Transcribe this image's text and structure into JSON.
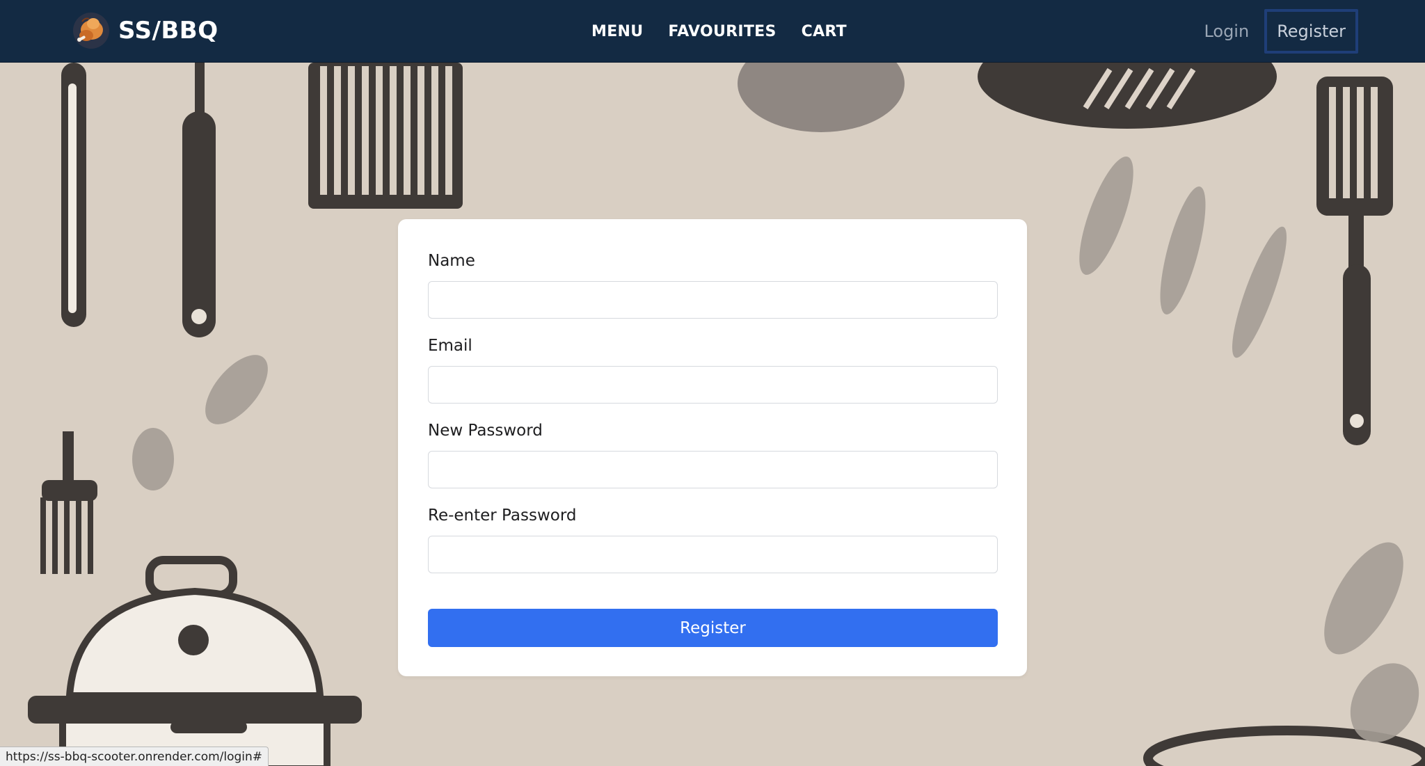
{
  "brand": {
    "name": "SS/BBQ",
    "logo_icon": "chicken-logo-icon"
  },
  "nav": {
    "menu": "MENU",
    "favourites": "FAVOURITES",
    "cart": "CART"
  },
  "auth": {
    "login": "Login",
    "register": "Register"
  },
  "form": {
    "fields": [
      {
        "label": "Name",
        "value": "",
        "placeholder": ""
      },
      {
        "label": "Email",
        "value": "",
        "placeholder": ""
      },
      {
        "label": "New Password",
        "value": "",
        "placeholder": ""
      },
      {
        "label": "Re-enter Password",
        "value": "",
        "placeholder": ""
      }
    ],
    "submit_label": "Register"
  },
  "status_bar": {
    "url": "https://ss-bbq-scooter.onrender.com/login#"
  },
  "colors": {
    "navbar_bg": "#132a43",
    "accent_button": "#326ff0",
    "page_bg": "#d9cfc3",
    "register_outline": "#1f3e78"
  }
}
